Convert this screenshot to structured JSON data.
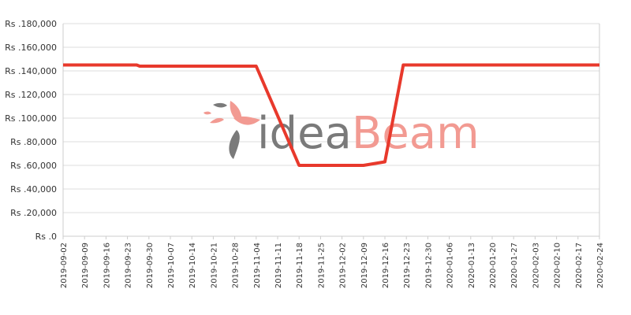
{
  "watermark": {
    "part1": "idea",
    "part2": "Beam",
    "color1": "#7a7a7a",
    "color2": "#f29a92",
    "icon": "feather-bird-icon"
  },
  "chart_data": {
    "type": "line",
    "ylim": [
      0,
      180000
    ],
    "yticks": [
      0,
      20000,
      40000,
      60000,
      80000,
      100000,
      120000,
      140000,
      160000,
      180000
    ],
    "ytick_labels": [
      "Rs .0",
      "Rs .20,000",
      "Rs .40,000",
      "Rs .60,000",
      "Rs .80,000",
      "Rs .100,000",
      "Rs .120,000",
      "Rs .140,000",
      "Rs .160,000",
      "Rs .180,000"
    ],
    "x_ticks": [
      "2019-09-02",
      "2019-09-09",
      "2019-09-16",
      "2019-09-23",
      "2019-09-30",
      "2019-10-07",
      "2019-10-14",
      "2019-10-21",
      "2019-10-28",
      "2019-11-04",
      "2019-11-11",
      "2019-11-18",
      "2019-11-25",
      "2019-12-02",
      "2019-12-09",
      "2019-12-16",
      "2019-12-23",
      "2019-12-30",
      "2020-01-06",
      "2020-01-13",
      "2020-01-20",
      "2020-01-27",
      "2020-02-03",
      "2020-02-10",
      "2020-02-17",
      "2020-02-24"
    ],
    "x_range": [
      "2019-09-02",
      "2020-02-24"
    ],
    "grid": true,
    "series": [
      {
        "color": "#e8392c",
        "points": [
          [
            "2019-09-02",
            145000
          ],
          [
            "2019-09-26",
            145000
          ],
          [
            "2019-09-27",
            144000
          ],
          [
            "2019-11-04",
            144000
          ],
          [
            "2019-11-18",
            60000
          ],
          [
            "2019-12-09",
            60000
          ],
          [
            "2019-12-16",
            63000
          ],
          [
            "2019-12-22",
            145000
          ],
          [
            "2020-02-24",
            145000
          ]
        ]
      }
    ]
  }
}
